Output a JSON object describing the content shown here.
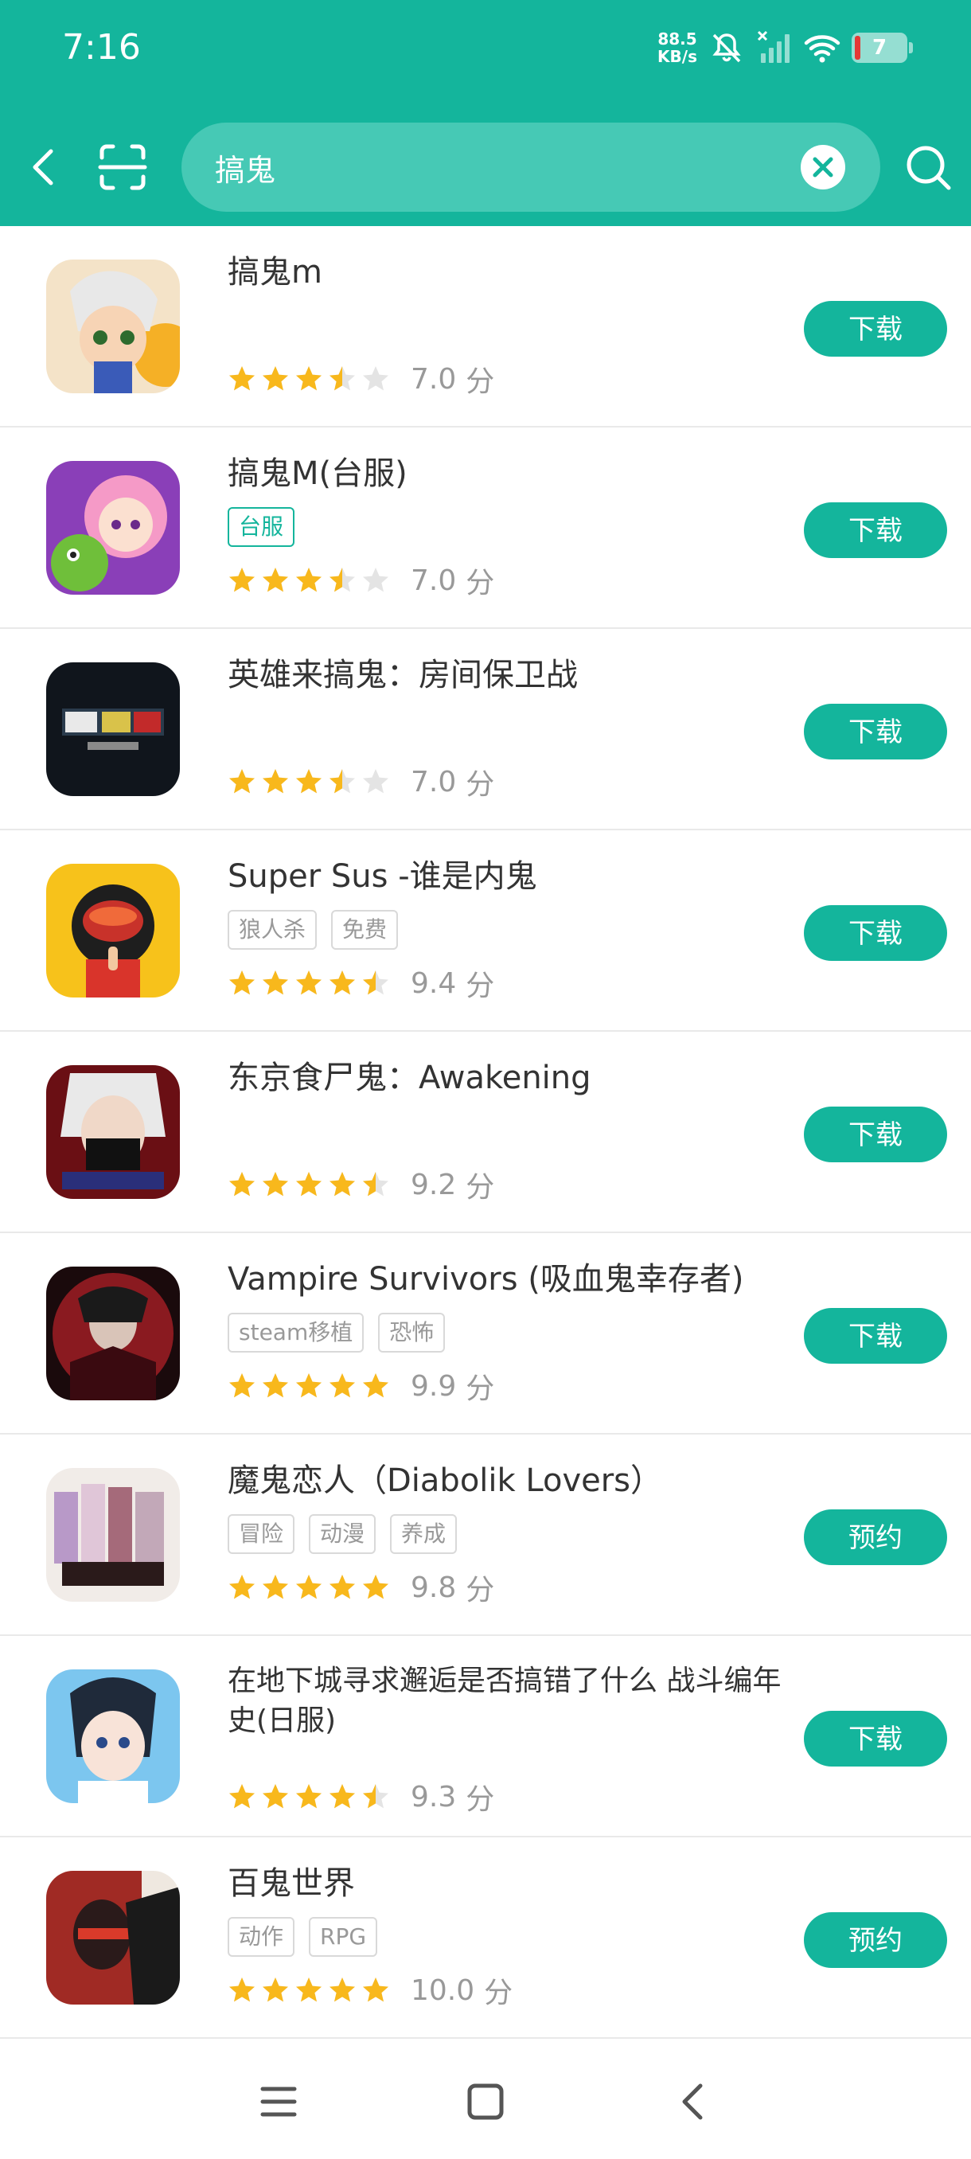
{
  "status_bar": {
    "time": "7:16",
    "net_speed_value": "88.5",
    "net_speed_unit": "KB/s",
    "battery": "7"
  },
  "search": {
    "query": "搞鬼"
  },
  "rating_unit": "分",
  "apps": [
    {
      "name": "搞鬼m",
      "tags": [],
      "rating": 3.5,
      "score": "7.0",
      "action": "下载"
    },
    {
      "name": "搞鬼M(台服)",
      "tags": [
        "台服"
      ],
      "rating": 3.5,
      "score": "7.0",
      "action": "下载"
    },
    {
      "name": "英雄来搞鬼：房间保卫战",
      "tags": [],
      "rating": 3.5,
      "score": "7.0",
      "action": "下载"
    },
    {
      "name": "Super Sus -谁是内鬼",
      "tags": [
        "狼人杀",
        "免费"
      ],
      "rating": 4.5,
      "score": "9.4",
      "action": "下载"
    },
    {
      "name": "东京食尸鬼：Awakening",
      "tags": [],
      "rating": 4.5,
      "score": "9.2",
      "action": "下载"
    },
    {
      "name": "Vampire Survivors (吸血鬼幸存者)",
      "tags": [
        "steam移植",
        "恐怖"
      ],
      "rating": 5,
      "score": "9.9",
      "action": "下载"
    },
    {
      "name": "魔鬼恋人（Diabolik Lovers）",
      "tags": [
        "冒险",
        "动漫",
        "养成"
      ],
      "rating": 5,
      "score": "9.8",
      "action": "预约"
    },
    {
      "name": "在地下城寻求邂逅是否搞错了什么 战斗编年史(日服)",
      "tags": [],
      "rating": 4.5,
      "score": "9.3",
      "action": "下载"
    },
    {
      "name": "百鬼世界",
      "tags": [
        "动作",
        "RPG"
      ],
      "rating": 5,
      "score": "10.0",
      "action": "预约"
    }
  ],
  "colors": {
    "accent": "#14b59c",
    "star": "#f8b81c",
    "star_empty": "#e4e4e4"
  }
}
